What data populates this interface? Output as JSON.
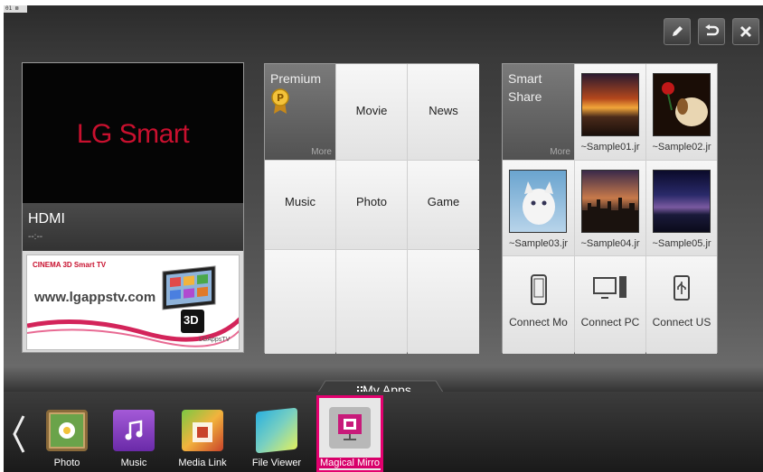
{
  "corner_tag": "01 ⊠",
  "top_buttons": [
    {
      "icon": "pencil-icon"
    },
    {
      "icon": "back-icon"
    },
    {
      "icon": "close-icon"
    }
  ],
  "left_card": {
    "brand_text": "LG Smart",
    "input_name": "HDMI",
    "input_sub": "--:--",
    "ad": {
      "brand": "CINEMA 3D Smart TV",
      "url": "www.lgappstv.com",
      "badge": "3D",
      "corner_logo": "LGAppsTV"
    }
  },
  "premium_grid": {
    "premium_title": "Premium",
    "more_label": "More",
    "cells": [
      "Movie",
      "News",
      "Music",
      "Photo",
      "Game",
      "",
      "",
      ""
    ]
  },
  "smart_share": {
    "title_line1": "Smart",
    "title_line2": "Share",
    "more_label": "More",
    "files": [
      "~Sample01.jr",
      "~Sample02.jr",
      "~Sample03.jr",
      "~Sample04.jr",
      "~Sample05.jr"
    ],
    "connects": [
      "Connect Mo",
      "Connect PC",
      "Connect US"
    ]
  },
  "dock": {
    "tab_label": "My Apps",
    "apps": [
      "Photo",
      "Music",
      "Media Link",
      "File Viewer",
      "Magical Mirro"
    ],
    "selected_app": "Magical Mirro",
    "accent_color": "#e3006f"
  }
}
